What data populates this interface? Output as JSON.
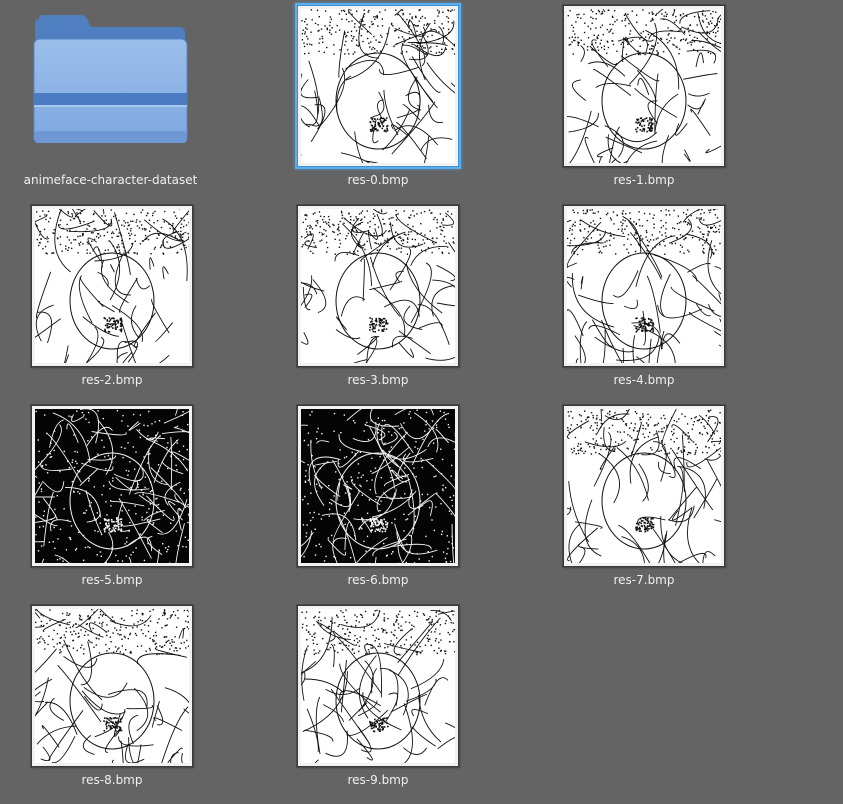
{
  "view": {
    "background": "#646464",
    "selected_index": 1,
    "accent": "#5ab0ee"
  },
  "items": [
    {
      "name": "animeface-character-dataset",
      "kind": "folder",
      "icon": "folder-icon"
    },
    {
      "name": "res-0.bmp",
      "kind": "image",
      "variant": "light"
    },
    {
      "name": "res-1.bmp",
      "kind": "image",
      "variant": "light"
    },
    {
      "name": "res-2.bmp",
      "kind": "image",
      "variant": "light"
    },
    {
      "name": "res-3.bmp",
      "kind": "image",
      "variant": "light"
    },
    {
      "name": "res-4.bmp",
      "kind": "image",
      "variant": "light"
    },
    {
      "name": "res-5.bmp",
      "kind": "image",
      "variant": "dark"
    },
    {
      "name": "res-6.bmp",
      "kind": "image",
      "variant": "dark"
    },
    {
      "name": "res-7.bmp",
      "kind": "image",
      "variant": "light"
    },
    {
      "name": "res-8.bmp",
      "kind": "image",
      "variant": "light"
    },
    {
      "name": "res-9.bmp",
      "kind": "image",
      "variant": "light"
    }
  ]
}
